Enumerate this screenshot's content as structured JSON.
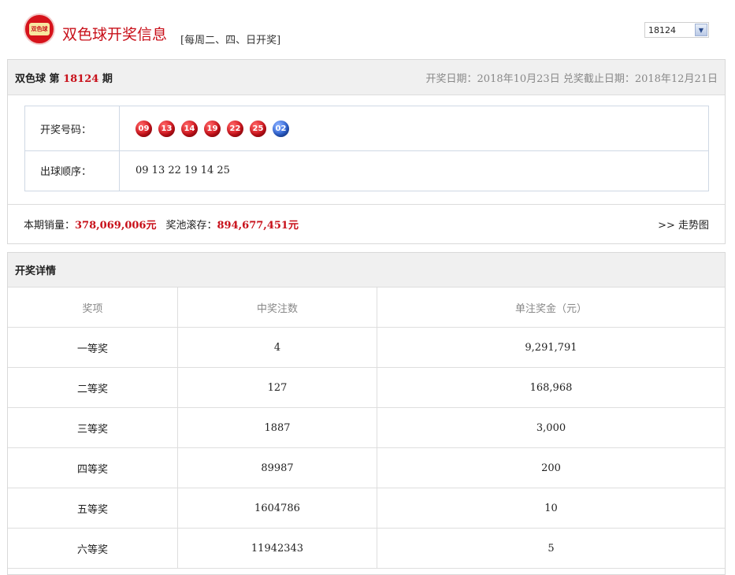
{
  "header": {
    "logo_text": "双色球 UNION LOTTO",
    "title": "双色球开奖信息",
    "subtitle": "[每周二、四、日开奖]",
    "issue_select_value": "18124"
  },
  "info": {
    "game_name": "双色球 第",
    "issue": "18124",
    "issue_suffix": "期",
    "draw_date_text": "开奖日期：2018年10月23日 兑奖截止日期：2018年12月21日"
  },
  "draw": {
    "numbers_label": "开奖号码：",
    "red_balls": [
      "09",
      "13",
      "14",
      "19",
      "22",
      "25"
    ],
    "blue_ball": "02",
    "order_label": "出球顺序：",
    "order_value": "09 13 22 19 14 25"
  },
  "sales": {
    "sales_label": "本期销量：",
    "sales_amount": "378,069,006元",
    "pool_label": "奖池滚存：",
    "pool_amount": "894,677,451元",
    "trend_link": ">> 走势图"
  },
  "details": {
    "title": "开奖详情",
    "headers": [
      "奖项",
      "中奖注数",
      "单注奖金（元）"
    ],
    "rows": [
      [
        "一等奖",
        "4",
        "9,291,791"
      ],
      [
        "二等奖",
        "127",
        "168,968"
      ],
      [
        "三等奖",
        "1887",
        "3,000"
      ],
      [
        "四等奖",
        "89987",
        "200"
      ],
      [
        "五等奖",
        "1604786",
        "10"
      ],
      [
        "六等奖",
        "11942343",
        "5"
      ]
    ]
  },
  "colors": {
    "accent_red": "#c8101a",
    "blue_ball": "#2d64d8"
  }
}
